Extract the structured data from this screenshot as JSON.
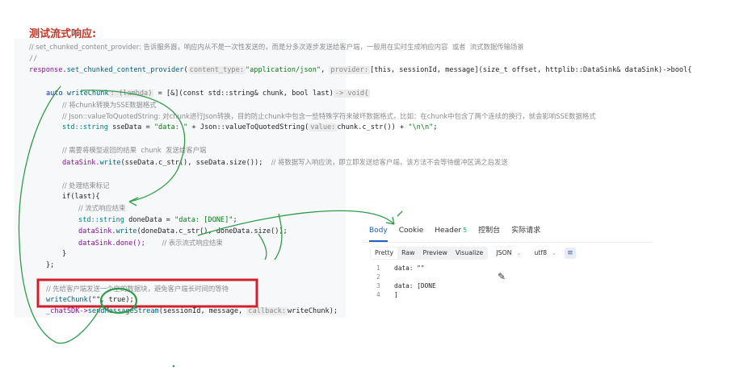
{
  "heading": "测试流式响应:",
  "code": {
    "l1": "// set_chunked_content_provider: 告诉服务器，响应内从不是一次性发送的，而是分多次逐步发送给客户端，一般用在实时生成响应内容  或者  流式数据传输场景",
    "l2": "//",
    "l3_obj": "response",
    "l3_fn": "set_chunked_content_provider",
    "l3_hint1": "content_type:",
    "l3_str": "\"application/json\"",
    "l3_hint2": "provider:",
    "l3_rest": "[this, sessionId, message](size_t offset, httplib::DataSink& dataSink)->bool{",
    "l4_kw": "auto",
    "l4_name": "writeChunk",
    "l4_hint": ": (lambda)",
    "l4_rest": " = [&](const std::string& chunk, bool last)",
    "l4_ret": "-> void{",
    "l5": "// 将chunk转换为SSE数据格式",
    "l6": "// Json::valueToQuotedString: 对chunk进行Json转换，目的防止chunk中包含一些特殊字符来破坏数据格式，比如：在chunk中包含了两个连续的换行，就会影响SSE数据格式",
    "l7_type": "std::string",
    "l7_var": " sseData = ",
    "l7_str1": "\"data: \"",
    "l7_mid": " + Json::valueToQuotedString(",
    "l7_hint": "value:",
    "l7_arg": "chunk.c_str())",
    "l7_plus": " + ",
    "l7_str2": "\"\\n\\n\"",
    "l7_end": ";",
    "l8": "// 需要将模型返回的结果  chunk  发送给客户端",
    "l9_obj": "dataSink.",
    "l9_fn": "write",
    "l9_args": "(sseData.c_str(), sseData.size());",
    "l9_cm": "// 将数据写入响应流，即立即发送给客户端，该方法不会等待缓冲区满之后发送",
    "l10": "// 处理结束标记",
    "l11": "if(last){",
    "l12": "// 流式响应结束",
    "l13_type": "std::string",
    "l13_var": " doneData = ",
    "l13_str": "\"data: [DONE]\"",
    "l13_end": ";",
    "l14_obj": "dataSink.",
    "l14_fn": "write",
    "l14_args": "(doneData.c_str(), doneData.size());",
    "l15_call": "dataSink.done();",
    "l15_cm": "// 表示流式响应结束",
    "l16": "}",
    "l17": "};",
    "l18": "// 先给客户端发送一个空的数据块，避免客户端长时间的等待",
    "l19_fn": "writeChunk",
    "l19_args": "(\"\", true);",
    "l20_obj": "_chatSDK->",
    "l20_fn": "sendMessageStream",
    "l20_args1": "(sessionId, message,",
    "l20_hint": "callback:",
    "l20_args2": "writeChunk);"
  },
  "panel": {
    "tabs": [
      {
        "label": "Body",
        "active": true
      },
      {
        "label": "Cookie",
        "active": false
      },
      {
        "label": "Header",
        "count": "5",
        "active": false
      },
      {
        "label": "控制台",
        "active": false
      },
      {
        "label": "实际请求",
        "active": false
      }
    ],
    "view_modes": [
      "Pretty",
      "Raw",
      "Preview",
      "Visualize"
    ],
    "format": "JSON",
    "encoding": "utf8",
    "wrap_icon": "wrap-lines-icon",
    "lines": [
      {
        "n": "1",
        "text": "data: \"\""
      },
      {
        "n": "2",
        "text": ""
      },
      {
        "n": "3",
        "text": "data: [DONE"
      },
      {
        "n": "4",
        "text": "]"
      }
    ]
  },
  "colors": {
    "heading": "#c0392b",
    "annotation_green": "#2e9c4a",
    "annotation_red": "#d21f2b",
    "active_tab": "#1f5fbf"
  }
}
